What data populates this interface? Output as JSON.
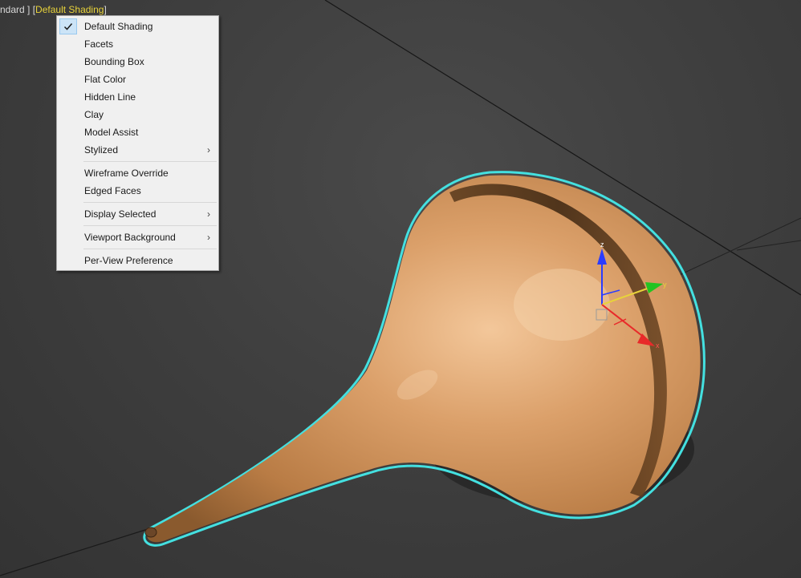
{
  "viewport": {
    "label_prefix": "ndard ]",
    "label_open": "[",
    "label_active": "Default Shading",
    "label_close": "]",
    "accent_color": "#e8d33a",
    "selection_color": "#44e0e0"
  },
  "gizmo": {
    "axis_x": "x",
    "axis_y": "y",
    "axis_z": "z"
  },
  "menu": {
    "items": [
      {
        "label": "Default Shading",
        "checked": true
      },
      {
        "label": "Facets"
      },
      {
        "label": "Bounding Box"
      },
      {
        "label": "Flat Color"
      },
      {
        "label": "Hidden Line"
      },
      {
        "label": "Clay"
      },
      {
        "label": "Model Assist"
      },
      {
        "label": "Stylized",
        "submenu": true
      },
      {
        "label": "Wireframe Override"
      },
      {
        "label": "Edged Faces"
      },
      {
        "label": "Display Selected",
        "submenu": true
      },
      {
        "label": "Viewport Background",
        "submenu": true
      },
      {
        "label": "Per-View Preference"
      }
    ],
    "submenu_glyph": "›"
  }
}
